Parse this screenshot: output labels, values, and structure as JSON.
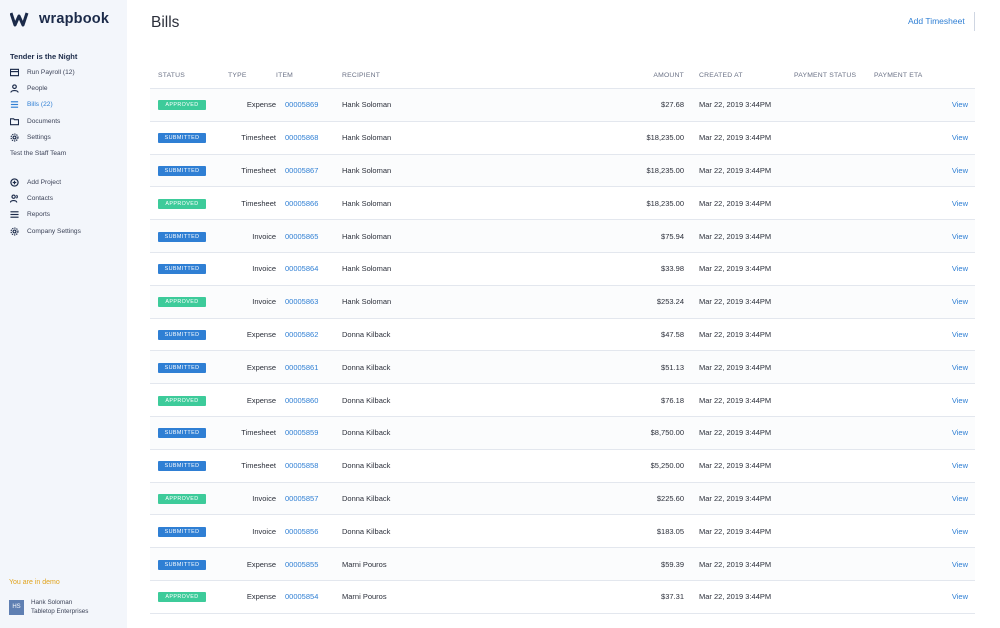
{
  "app": {
    "logo_text": "wrapbook"
  },
  "sidebar": {
    "project_title": "Tender is the Night",
    "items": [
      {
        "label": "Run Payroll (12)",
        "icon": "payroll-icon",
        "active": false
      },
      {
        "label": "People",
        "icon": "people-icon",
        "active": false
      },
      {
        "label": "Bills (22)",
        "icon": "bills-icon",
        "active": true
      },
      {
        "label": "Documents",
        "icon": "documents-icon",
        "active": false
      },
      {
        "label": "Settings",
        "icon": "gear-icon",
        "active": false
      }
    ],
    "sub_link": "Test the Staff Team",
    "items2": [
      {
        "label": "Add Project",
        "icon": "plus-circle-icon"
      },
      {
        "label": "Contacts",
        "icon": "contacts-icon"
      },
      {
        "label": "Reports",
        "icon": "reports-icon"
      },
      {
        "label": "Company Settings",
        "icon": "gear-icon"
      }
    ],
    "demo_prefix": "You are in ",
    "demo_word": "demo",
    "user_initials": "HS",
    "user_name": "Hank Soloman",
    "user_company": "Tabletop Enterprises"
  },
  "header": {
    "title": "Bills",
    "add_timesheet": "Add Timesheet"
  },
  "table": {
    "columns": {
      "status": "Status",
      "type": "Type",
      "item": "Item",
      "recipient": "Recipient",
      "amount": "Amount",
      "created": "Created At",
      "payment_status": "Payment Status",
      "payment_eta": "Payment ETA"
    },
    "view_label": "View",
    "rows": [
      {
        "status": "APPROVED",
        "type": "Expense",
        "item": "00005869",
        "recipient": "Hank Soloman",
        "amount": "$27.68",
        "created": "Mar 22, 2019 3:44PM"
      },
      {
        "status": "SUBMITTED",
        "type": "Timesheet",
        "item": "00005868",
        "recipient": "Hank Soloman",
        "amount": "$18,235.00",
        "created": "Mar 22, 2019 3:44PM"
      },
      {
        "status": "SUBMITTED",
        "type": "Timesheet",
        "item": "00005867",
        "recipient": "Hank Soloman",
        "amount": "$18,235.00",
        "created": "Mar 22, 2019 3:44PM"
      },
      {
        "status": "APPROVED",
        "type": "Timesheet",
        "item": "00005866",
        "recipient": "Hank Soloman",
        "amount": "$18,235.00",
        "created": "Mar 22, 2019 3:44PM"
      },
      {
        "status": "SUBMITTED",
        "type": "Invoice",
        "item": "00005865",
        "recipient": "Hank Soloman",
        "amount": "$75.94",
        "created": "Mar 22, 2019 3:44PM"
      },
      {
        "status": "SUBMITTED",
        "type": "Invoice",
        "item": "00005864",
        "recipient": "Hank Soloman",
        "amount": "$33.98",
        "created": "Mar 22, 2019 3:44PM"
      },
      {
        "status": "APPROVED",
        "type": "Invoice",
        "item": "00005863",
        "recipient": "Hank Soloman",
        "amount": "$253.24",
        "created": "Mar 22, 2019 3:44PM"
      },
      {
        "status": "SUBMITTED",
        "type": "Expense",
        "item": "00005862",
        "recipient": "Donna Kilback",
        "amount": "$47.58",
        "created": "Mar 22, 2019 3:44PM"
      },
      {
        "status": "SUBMITTED",
        "type": "Expense",
        "item": "00005861",
        "recipient": "Donna Kilback",
        "amount": "$51.13",
        "created": "Mar 22, 2019 3:44PM"
      },
      {
        "status": "APPROVED",
        "type": "Expense",
        "item": "00005860",
        "recipient": "Donna Kilback",
        "amount": "$76.18",
        "created": "Mar 22, 2019 3:44PM"
      },
      {
        "status": "SUBMITTED",
        "type": "Timesheet",
        "item": "00005859",
        "recipient": "Donna Kilback",
        "amount": "$8,750.00",
        "created": "Mar 22, 2019 3:44PM"
      },
      {
        "status": "SUBMITTED",
        "type": "Timesheet",
        "item": "00005858",
        "recipient": "Donna Kilback",
        "amount": "$5,250.00",
        "created": "Mar 22, 2019 3:44PM"
      },
      {
        "status": "APPROVED",
        "type": "Invoice",
        "item": "00005857",
        "recipient": "Donna Kilback",
        "amount": "$225.60",
        "created": "Mar 22, 2019 3:44PM"
      },
      {
        "status": "SUBMITTED",
        "type": "Invoice",
        "item": "00005856",
        "recipient": "Donna Kilback",
        "amount": "$183.05",
        "created": "Mar 22, 2019 3:44PM"
      },
      {
        "status": "SUBMITTED",
        "type": "Expense",
        "item": "00005855",
        "recipient": "Marni Pouros",
        "amount": "$59.39",
        "created": "Mar 22, 2019 3:44PM"
      },
      {
        "status": "APPROVED",
        "type": "Expense",
        "item": "00005854",
        "recipient": "Marni Pouros",
        "amount": "$37.31",
        "created": "Mar 22, 2019 3:44PM"
      }
    ]
  },
  "colors": {
    "approved": "#3dcb9a",
    "submitted": "#2f7fd4",
    "link": "#2f7fd4"
  }
}
